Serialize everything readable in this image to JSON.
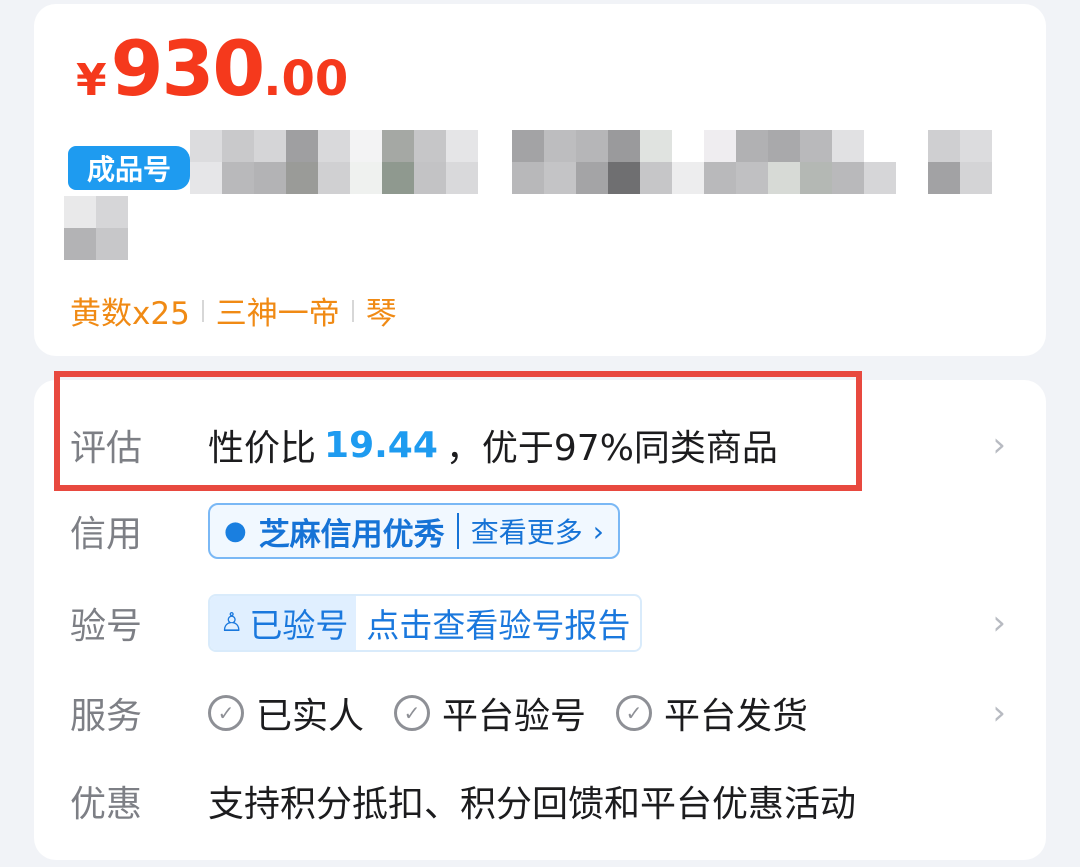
{
  "price": {
    "currency": "¥",
    "integer": "930",
    "decimal": ".00"
  },
  "title": {
    "badge": "成品号"
  },
  "tags": [
    "黄数x25",
    "三神一帝",
    "琴"
  ],
  "rows": {
    "evaluate": {
      "label": "评估",
      "prefix": "性价比",
      "value": "19.44",
      "suffix": "，优于97%同类商品"
    },
    "credit": {
      "label": "信用",
      "badge": "芝麻信用优秀",
      "more": "查看更多",
      "arrow": "›"
    },
    "verify": {
      "label": "验号",
      "status": "已验号",
      "link": "点击查看验号报告"
    },
    "service": {
      "label": "服务",
      "items": [
        "已实人",
        "平台验号",
        "平台发货"
      ]
    },
    "discount": {
      "label": "优惠",
      "text": "支持积分抵扣、积分回馈和平台优惠活动"
    }
  },
  "icons": {
    "chevron": "chevron-right-icon",
    "check": "check-circle-icon",
    "drop": "sesame-drop-icon",
    "verified": "verified-person-icon"
  },
  "colors": {
    "price": "#f5391c",
    "accent": "#1e9bf0",
    "tag": "#f08a14",
    "highlight": "#e8493f"
  }
}
